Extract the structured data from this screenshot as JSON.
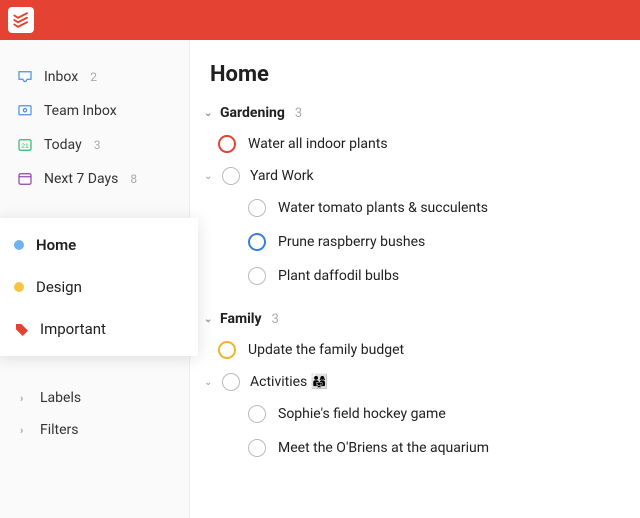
{
  "brand": {
    "accent": "#e44232"
  },
  "sidebar": {
    "nav": [
      {
        "label": "Inbox",
        "count": "2",
        "icon": "inbox"
      },
      {
        "label": "Team Inbox",
        "count": "",
        "icon": "team-inbox"
      },
      {
        "label": "Today",
        "count": "3",
        "icon": "today"
      },
      {
        "label": "Next 7 Days",
        "count": "8",
        "icon": "calendar"
      }
    ],
    "projects": [
      {
        "label": "Home",
        "color": "#6fb3f2",
        "active": true
      },
      {
        "label": "Design",
        "color": "#f5c542",
        "active": false
      },
      {
        "label": "Important",
        "color": "#e44232",
        "tag": true
      }
    ],
    "sections": [
      {
        "label": "Labels"
      },
      {
        "label": "Filters"
      }
    ]
  },
  "main": {
    "title": "Home",
    "groups": [
      {
        "name": "Gardening",
        "count": "3",
        "items": [
          {
            "type": "task",
            "level": 1,
            "priority": "red",
            "text": "Water all indoor plants"
          },
          {
            "type": "subsection",
            "level": 1,
            "text": "Yard Work"
          },
          {
            "type": "task",
            "level": 2,
            "priority": "",
            "text": "Water tomato plants & succulents"
          },
          {
            "type": "task",
            "level": 2,
            "priority": "blue",
            "text": "Prune raspberry bushes"
          },
          {
            "type": "task",
            "level": 2,
            "priority": "",
            "text": "Plant daffodil bulbs"
          }
        ]
      },
      {
        "name": "Family",
        "count": "3",
        "items": [
          {
            "type": "task",
            "level": 1,
            "priority": "yellow",
            "text": "Update the family budget"
          },
          {
            "type": "subsection",
            "level": 1,
            "text": "Activities 👨‍👩‍👧"
          },
          {
            "type": "task",
            "level": 2,
            "priority": "",
            "text": "Sophie's field hockey game"
          },
          {
            "type": "task",
            "level": 2,
            "priority": "",
            "text": "Meet the O'Briens at the aquarium"
          }
        ]
      }
    ]
  }
}
